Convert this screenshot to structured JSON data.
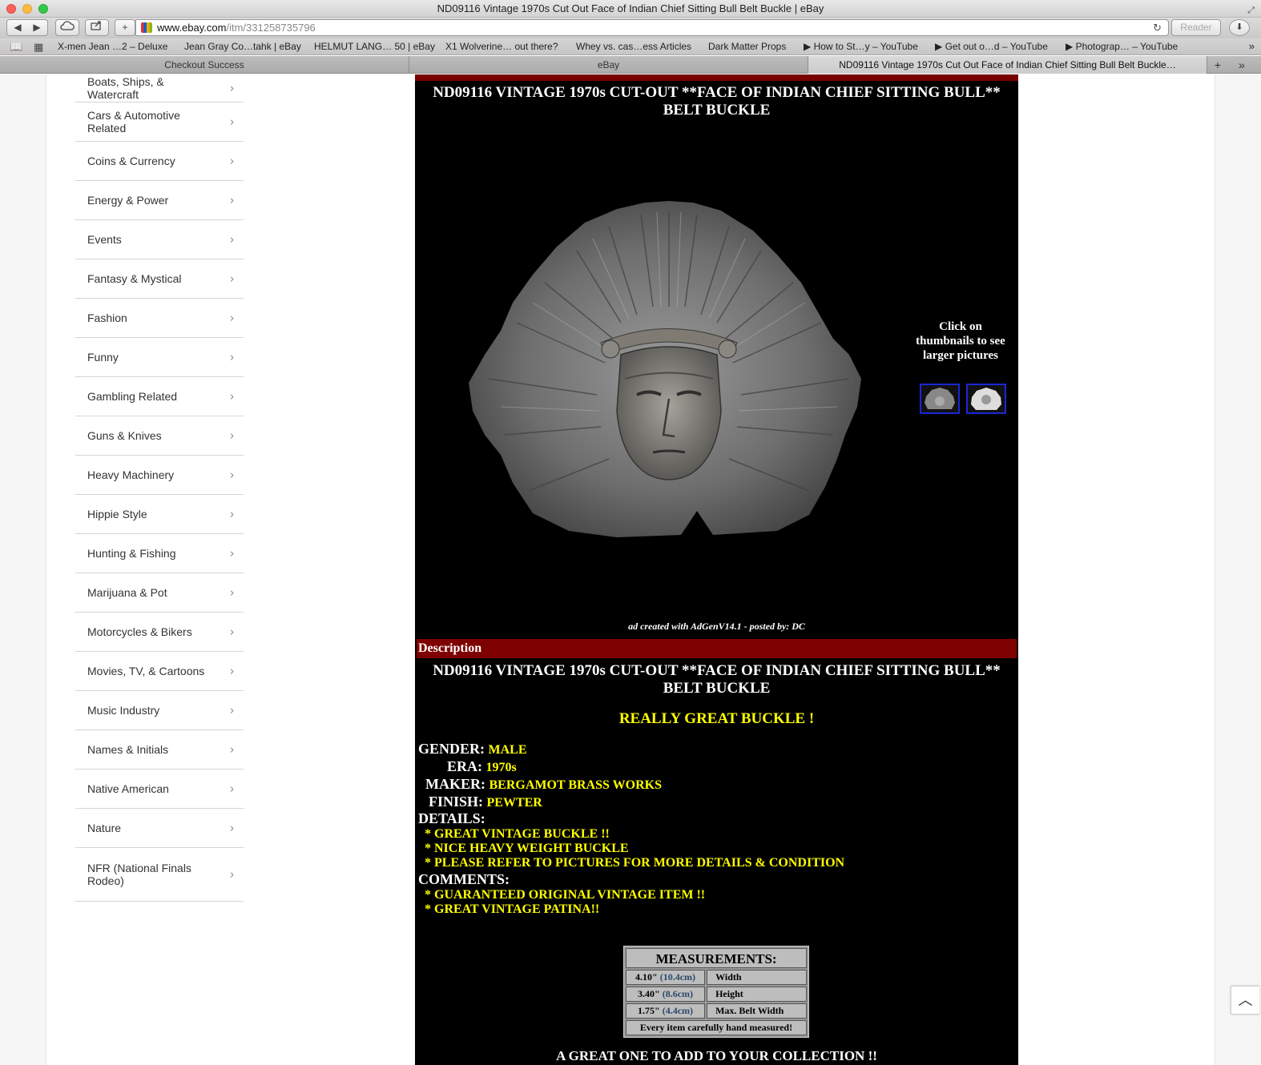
{
  "window": {
    "title": "ND09116 Vintage 1970s Cut Out Face of Indian Chief Sitting Bull Belt Buckle | eBay"
  },
  "toolbar": {
    "back_icon": "◀",
    "forward_icon": "▶",
    "add_icon": "+",
    "url_host": "www.ebay.com",
    "url_path": "/itm/331258735796",
    "reload_icon": "↻",
    "reader_label": "Reader"
  },
  "bookmarks": [
    {
      "label": "X-men Jean …2 – Deluxe"
    },
    {
      "label": "Jean Gray Co…tahk | eBay"
    },
    {
      "label": "HELMUT LANG… 50 | eBay"
    },
    {
      "label": "X1 Wolverine… out there?"
    },
    {
      "label": "Whey vs. cas…ess Articles"
    },
    {
      "label": "Dark Matter Props"
    },
    {
      "label": "▶ How to St…y – YouTube"
    },
    {
      "label": "▶ Get out o…d – YouTube"
    },
    {
      "label": "▶ Photograp… – YouTube"
    }
  ],
  "tabs": [
    {
      "label": "Checkout Success"
    },
    {
      "label": "eBay"
    },
    {
      "label": "ND09116 Vintage 1970s Cut Out Face of Indian Chief Sitting Bull Belt Buckle…"
    }
  ],
  "sidebar": {
    "items": [
      {
        "label": "Boats, Ships, & Watercraft"
      },
      {
        "label": "Cars & Automotive Related"
      },
      {
        "label": "Coins & Currency"
      },
      {
        "label": "Energy & Power"
      },
      {
        "label": "Events"
      },
      {
        "label": "Fantasy & Mystical"
      },
      {
        "label": "Fashion"
      },
      {
        "label": "Funny"
      },
      {
        "label": "Gambling Related"
      },
      {
        "label": "Guns & Knives"
      },
      {
        "label": "Heavy Machinery"
      },
      {
        "label": "Hippie Style"
      },
      {
        "label": "Hunting & Fishing"
      },
      {
        "label": "Marijuana & Pot"
      },
      {
        "label": "Motorcycles & Bikers"
      },
      {
        "label": "Movies, TV, & Cartoons"
      },
      {
        "label": "Music Industry"
      },
      {
        "label": "Names & Initials"
      },
      {
        "label": "Native American"
      },
      {
        "label": "Nature"
      },
      {
        "label": "NFR (National Finals Rodeo)"
      }
    ],
    "chevron": "›"
  },
  "listing": {
    "title": "ND09116 VINTAGE 1970s CUT-OUT **FACE OF INDIAN CHIEF SITTING BULL** BELT BUCKLE",
    "thumb_caption": "Click on thumbnails to see larger pictures",
    "credit": "ad created with AdGenV14.1 - posted by: DC",
    "description_label": "Description",
    "description_title": "ND09116 VINTAGE 1970s CUT-OUT **FACE OF INDIAN CHIEF SITTING BULL** BELT BUCKLE",
    "tagline": "REALLY GREAT BUCKLE !",
    "specs": {
      "gender_label": "GENDER:",
      "gender": "MALE",
      "era_label": "ERA:",
      "era": "1970s",
      "maker_label": "MAKER:",
      "maker": "BERGAMOT BRASS WORKS",
      "finish_label": "FINISH:",
      "finish": "PEWTER"
    },
    "details_label": "DETAILS:",
    "details": [
      "* GREAT VINTAGE BUCKLE !!",
      "* NICE HEAVY WEIGHT BUCKLE",
      "* PLEASE REFER TO PICTURES FOR MORE DETAILS & CONDITION"
    ],
    "comments_label": "COMMENTS:",
    "comments": [
      "* GUARANTEED ORIGINAL VINTAGE ITEM !!",
      "* GREAT VINTAGE PATINA!!"
    ],
    "measurements": {
      "title": "MEASUREMENTS:",
      "rows": [
        {
          "inch": "4.10\"",
          "cm": "(10.4cm)",
          "label": "Width"
        },
        {
          "inch": "3.40\"",
          "cm": "(8.6cm)",
          "label": "Height"
        },
        {
          "inch": "1.75\"",
          "cm": "(4.4cm)",
          "label": "Max. Belt Width"
        }
      ],
      "footer": "Every item carefully hand measured!"
    },
    "closing": "A GREAT ONE TO ADD TO YOUR COLLECTION !!"
  },
  "colors": {
    "listing_bg": "#000000",
    "highlight_yellow": "#ffff00",
    "description_bar": "#7f0000",
    "thumb_border": "#1a26d6"
  }
}
